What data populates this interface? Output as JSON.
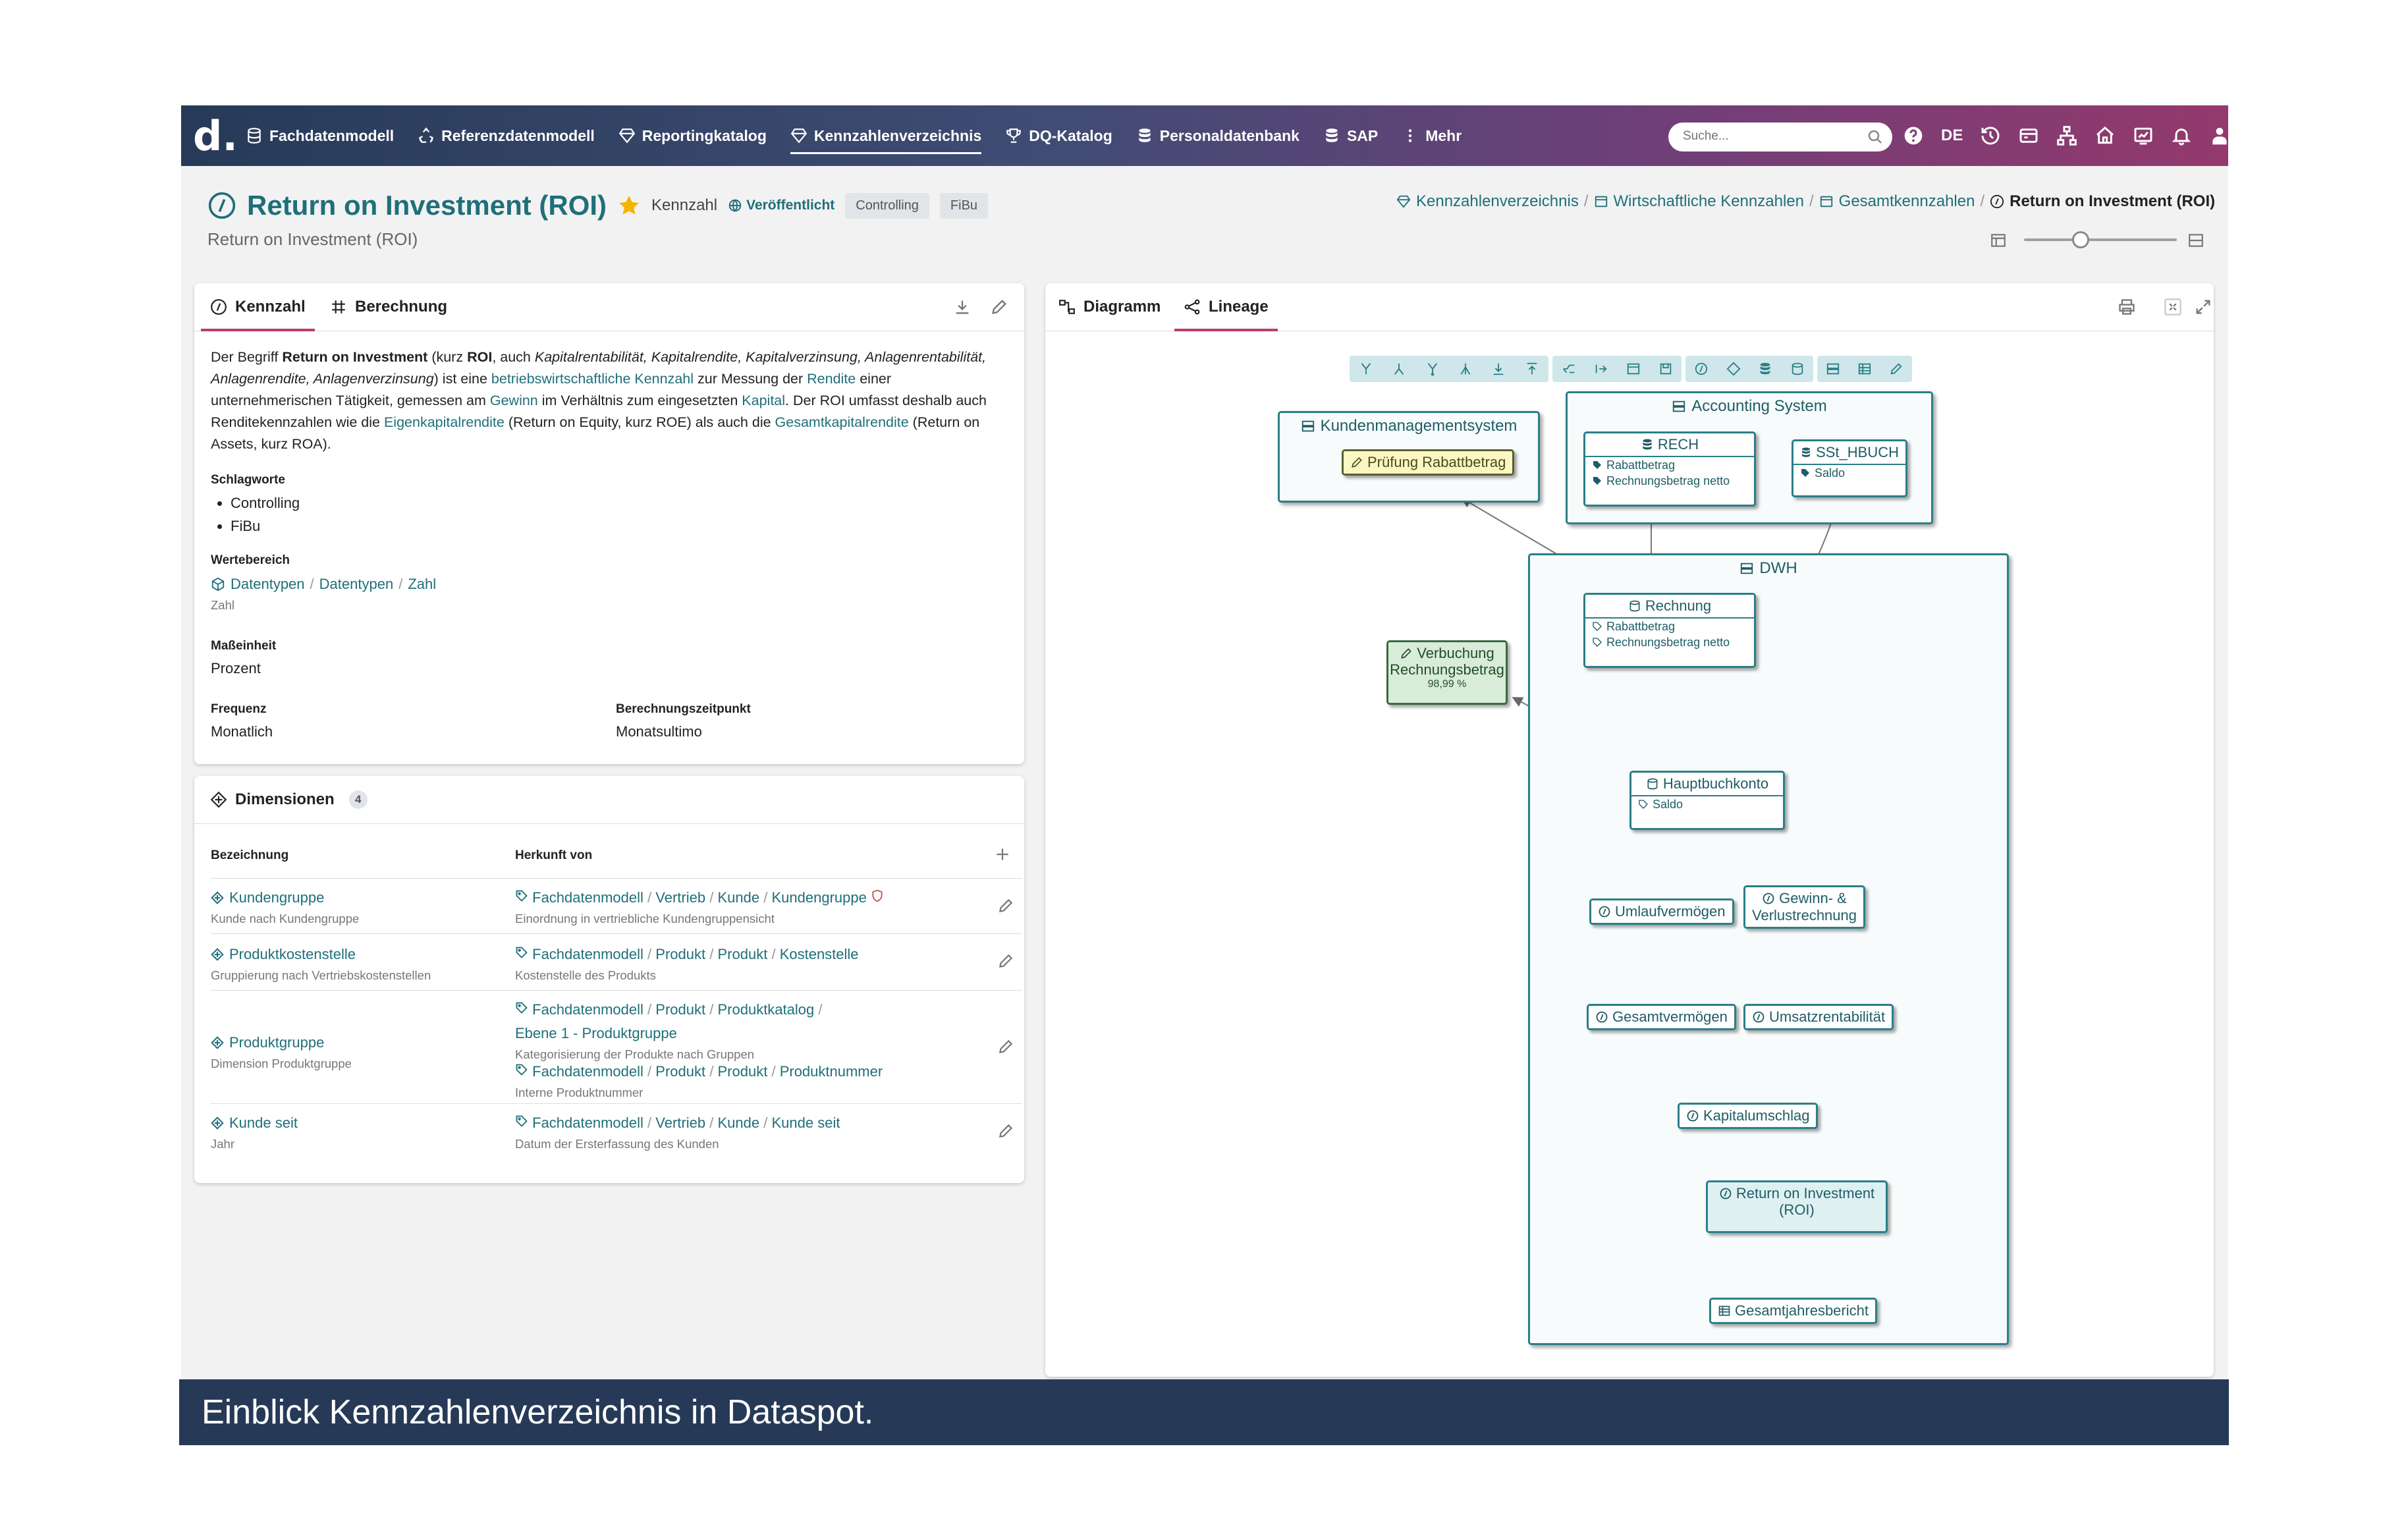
{
  "app": {
    "logo": "d."
  },
  "nav": {
    "items": [
      {
        "label": "Fachdatenmodell",
        "icon": "database-icon"
      },
      {
        "label": "Referenzdatenmodell",
        "icon": "recycle-icon"
      },
      {
        "label": "Reportingkatalog",
        "icon": "diamond-icon"
      },
      {
        "label": "Kennzahlenverzeichnis",
        "icon": "diamond-icon",
        "active": true
      },
      {
        "label": "DQ-Katalog",
        "icon": "trophy-icon"
      },
      {
        "label": "Personaldatenbank",
        "icon": "database-icon"
      },
      {
        "label": "SAP",
        "icon": "database-icon"
      },
      {
        "label": "Mehr",
        "icon": "more-icon"
      }
    ],
    "search_placeholder": "Suche...",
    "language": "DE"
  },
  "header": {
    "title": "Return on Investment (ROI)",
    "type": "Kennzahl",
    "status": "Veröffentlicht",
    "tags": [
      "Controlling",
      "FiBu"
    ],
    "subtitle": "Return on Investment (ROI)",
    "breadcrumb": [
      "Kennzahlenverzeichnis",
      "Wirtschaftliche Kennzahlen",
      "Gesamtkennzahlen",
      "Return on Investment (ROI)"
    ]
  },
  "left_card": {
    "tabs": [
      "Kennzahl",
      "Berechnung"
    ],
    "description": {
      "p1": "Der Begriff ",
      "b1": "Return on Investment",
      "p2": " (kurz ",
      "b2": "ROI",
      "p3": ", auch ",
      "i1": "Kapitalrentabilität, Kapitalrendite, Kapitalverzinsung, Anlagenrentabilität, Anlagenrendite, Anlagenverzinsung",
      "p4": ") ist eine ",
      "l1": "betriebswirtschaftliche Kennzahl",
      "p5": " zur Messung der ",
      "l2": "Rendite",
      "p6": " einer unternehmerischen Tätigkeit, gemessen am ",
      "l3": "Gewinn",
      "p7": " im Verhältnis zum eingesetzten ",
      "l4": "Kapital",
      "p8": ". Der ROI umfasst deshalb auch Renditekennzahlen wie die ",
      "l5": "Eigenkapitalrendite",
      "p9": " (Return on Equity, kurz ROE) als auch die ",
      "l6": "Gesamtkapitalrendite",
      "p10": " (Return on Assets, kurz ROA)."
    },
    "schlagworte_label": "Schlagworte",
    "schlagworte": [
      "Controlling",
      "FiBu"
    ],
    "wertebereich_label": "Wertebereich",
    "wertebereich_path": [
      "Datentypen",
      "Datentypen",
      "Zahl"
    ],
    "wertebereich_sub": "Zahl",
    "masseinheit_label": "Maßeinheit",
    "masseinheit": "Prozent",
    "frequenz_label": "Frequenz",
    "frequenz": "Monatlich",
    "zeitpunkt_label": "Berechnungszeitpunkt",
    "zeitpunkt": "Monatsultimo"
  },
  "dimensionen": {
    "title": "Dimensionen",
    "count": "4",
    "col_name": "Bezeichnung",
    "col_source": "Herkunft von",
    "rows": [
      {
        "name": "Kundengruppe",
        "desc": "Kunde nach Kundengruppe",
        "path": [
          "Fachdatenmodell",
          "Vertrieb",
          "Kunde",
          "Kundengruppe"
        ],
        "path_desc": "Einordnung in vertriebliche Kundengruppensicht"
      },
      {
        "name": "Produktkostenstelle",
        "desc": "Gruppierung nach Vertriebskostenstellen",
        "path": [
          "Fachdatenmodell",
          "Produkt",
          "Produkt",
          "Kostenstelle"
        ],
        "path_desc": "Kostenstelle des Produkts"
      },
      {
        "name": "Produktgruppe",
        "desc": "Dimension Produktgruppe",
        "path": [
          "Fachdatenmodell",
          "Produkt",
          "Produktkatalog",
          "Ebene 1 - Produktgruppe"
        ],
        "path_desc": "Kategorisierung der Produkte nach Gruppen",
        "path2": [
          "Fachdatenmodell",
          "Produkt",
          "Produkt",
          "Produktnummer"
        ],
        "path2_desc": "Interne Produktnummer"
      },
      {
        "name": "Kunde seit",
        "desc": "Jahr",
        "path": [
          "Fachdatenmodell",
          "Vertrieb",
          "Kunde",
          "Kunde seit"
        ],
        "path_desc": "Datum der Ersterfassung des Kunden"
      }
    ]
  },
  "right_card": {
    "tabs": [
      "Diagramm",
      "Lineage"
    ]
  },
  "lineage": {
    "kms": {
      "title": "Kundenmanagementsystem",
      "node": "Prüfung Rabattbetrag"
    },
    "accounting": {
      "title": "Accounting System",
      "rech": "RECH",
      "rech_attrs": [
        "Rabattbetrag",
        "Rechnungsbetrag netto"
      ],
      "sst": "SSt_HBUCH",
      "sst_attrs": [
        "Saldo"
      ]
    },
    "dwh": {
      "title": "DWH",
      "rechnung": "Rechnung",
      "rechnung_attrs": [
        "Rabattbetrag",
        "Rechnungsbetrag netto"
      ],
      "hauptbuch": "Hauptbuchkonto",
      "hauptbuch_attrs": [
        "Saldo"
      ]
    },
    "verbuchung": {
      "line1": "Verbuchung",
      "line2": "Rechnungsbetrag",
      "value": "98,99 %"
    },
    "kpis": {
      "umlauf": "Umlaufvermögen",
      "guv1": "Gewinn- &",
      "guv2": "Verlustrechnung",
      "gesamt": "Gesamtvermögen",
      "umsatz": "Umsatzrentabilität",
      "kapital": "Kapitalumschlag",
      "roi1": "Return on Investment",
      "roi2": "(ROI)",
      "report": "Gesamtjahresbericht"
    },
    "colors": {
      "node_border": "#2a7f87",
      "rule_node": "#fbf7c2",
      "quality_node": "#d8ecd9",
      "roi_fill": "#dff0f2"
    }
  },
  "caption": "Einblick Kennzahlenverzeichnis in Dataspot."
}
